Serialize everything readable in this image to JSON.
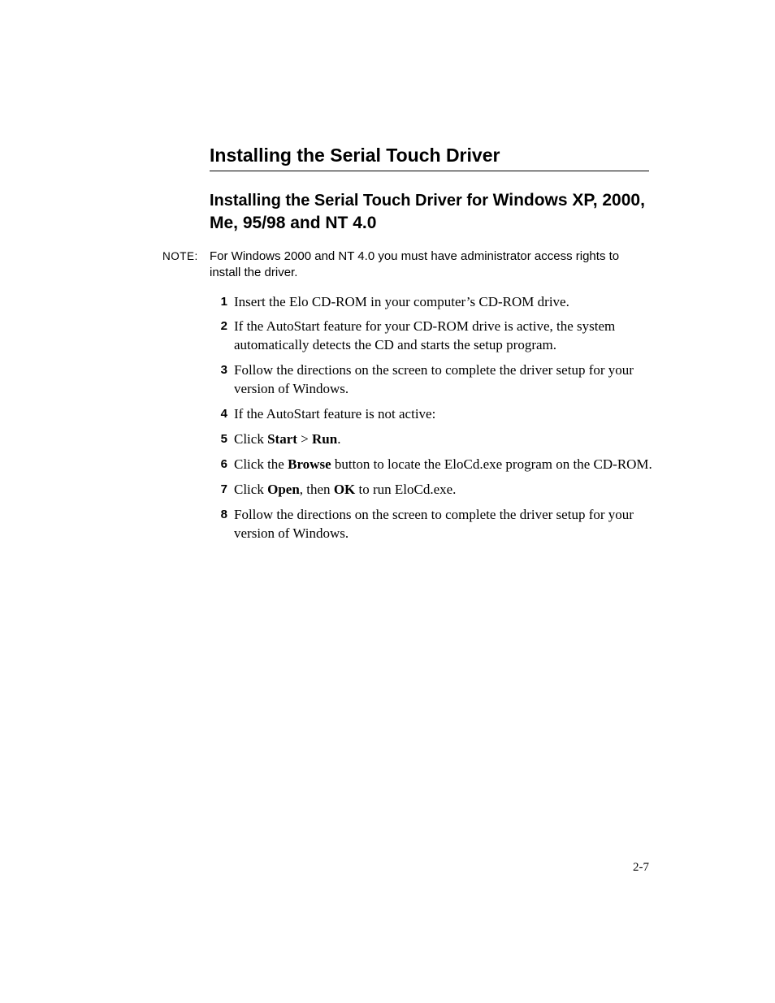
{
  "heading1": "Installing the Serial Touch Driver",
  "heading2_prefix": "Installing the Serial Touch Driver for ",
  "heading2_emph": "Windows XP, 2000, Me, 95/98 and NT 4.0",
  "note_label": "NOTE:",
  "note_text": "For Windows 2000 and NT 4.0 you must have administrator access rights to install the driver.",
  "steps": [
    {
      "n": "1",
      "segs": [
        {
          "t": "Insert the Elo CD-ROM in your computer’s CD-ROM drive."
        }
      ]
    },
    {
      "n": "2",
      "segs": [
        {
          "t": "If the AutoStart feature for your CD-ROM drive is active, the system automatically detects the CD and starts the setup program."
        }
      ]
    },
    {
      "n": "3",
      "segs": [
        {
          "t": "Follow the directions on the screen to complete the driver setup for your version of Windows."
        }
      ]
    },
    {
      "n": "4",
      "segs": [
        {
          "t": "If the AutoStart feature is not active:"
        }
      ]
    },
    {
      "n": "5",
      "segs": [
        {
          "t": "Click "
        },
        {
          "t": "Start",
          "b": true
        },
        {
          "t": " > "
        },
        {
          "t": "Run",
          "b": true
        },
        {
          "t": "."
        }
      ]
    },
    {
      "n": "6",
      "segs": [
        {
          "t": "Click the "
        },
        {
          "t": "Browse",
          "b": true
        },
        {
          "t": " button to locate the EloCd.exe program on the CD-ROM."
        }
      ]
    },
    {
      "n": "7",
      "segs": [
        {
          "t": "Click "
        },
        {
          "t": "Open",
          "b": true
        },
        {
          "t": ", then "
        },
        {
          "t": "OK",
          "b": true
        },
        {
          "t": " to run EloCd.exe."
        }
      ]
    },
    {
      "n": "8",
      "segs": [
        {
          "t": "Follow the directions on the screen to complete the driver setup for your version of Windows."
        }
      ]
    }
  ],
  "page_number": "2-7"
}
